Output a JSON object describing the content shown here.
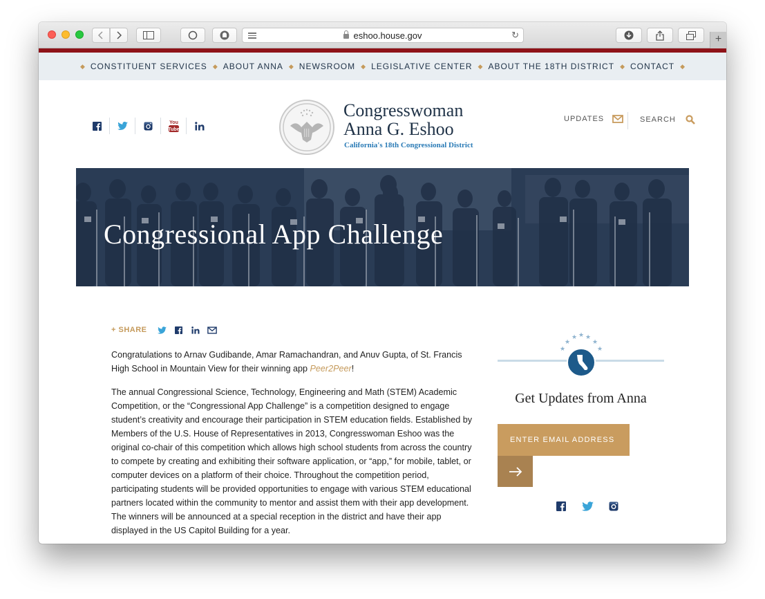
{
  "browser": {
    "url": "eshoo.house.gov"
  },
  "nav": {
    "items": [
      "CONSTITUENT SERVICES",
      "ABOUT ANNA",
      "NEWSROOM",
      "LEGISLATIVE CENTER",
      "ABOUT THE 18TH DISTRICT",
      "CONTACT"
    ]
  },
  "header": {
    "social_icons": [
      "facebook-icon",
      "twitter-icon",
      "instagram-icon",
      "youtube-icon",
      "linkedin-icon"
    ],
    "logo_line1": "Congresswoman",
    "logo_line2": "Anna G. Eshoo",
    "logo_sub": "California's 18th Congressional District",
    "updates_label": "UPDATES",
    "search_label": "SEARCH"
  },
  "hero": {
    "title": "Congressional App Challenge"
  },
  "share": {
    "label": "+ SHARE"
  },
  "article": {
    "p1_before": "Congratulations to Arnav Gudibande, Amar Ramachandran, and Anuv Gupta, of St. Francis High School in Mountain View for their winning app ",
    "p1_link": "Peer2Peer",
    "p1_after": "!",
    "p2": "The annual Congressional Science, Technology, Engineering and Math (STEM) Academic Competition, or the “Congressional App Challenge” is a competition designed to engage student’s creativity and encourage their participation in STEM education fields. Established by Members of the U.S. House of Representatives in 2013, Congresswoman Eshoo was the original co-chair of this competition which allows high school students from across the country to compete by creating and exhibiting their software application, or “app,” for mobile, tablet, or computer devices on a platform of their choice. Throughout the competition period, participating students will be provided opportunities to engage with various STEM educational partners located within the community to mentor and assist them with their app development. The winners will be announced at a special reception in the district and have their app displayed in the US Capitol Building for a year."
  },
  "signup": {
    "title": "Get Updates from Anna",
    "email_placeholder": "ENTER EMAIL ADDRESS"
  },
  "colors": {
    "navy": "#1f3247",
    "gold": "#c59a5b",
    "red": "#8e1319",
    "blue": "#2a7bb6"
  }
}
